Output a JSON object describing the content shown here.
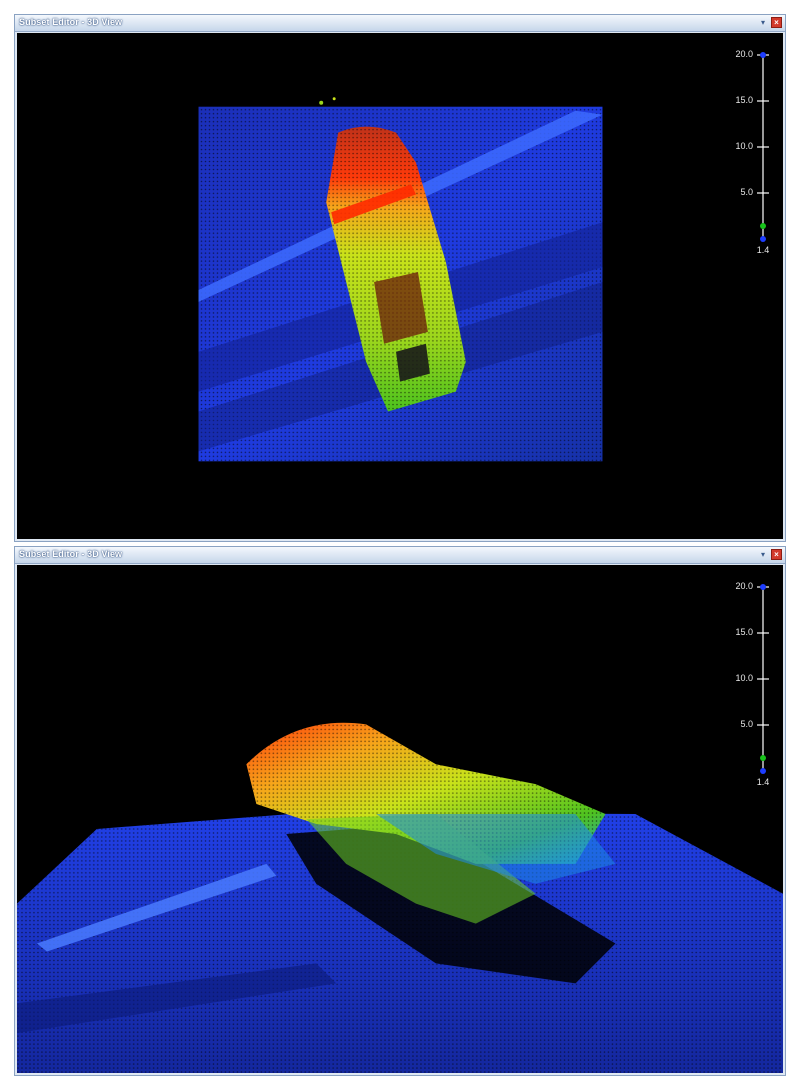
{
  "windows": [
    {
      "title": "Subset Editor - 3D View",
      "scale": {
        "ticks": [
          "20.0",
          "15.0",
          "10.0",
          "5.0"
        ],
        "min_label": "1.4",
        "max_value": 20.0,
        "marker_value": 1.4
      }
    },
    {
      "title": "Subset Editor - 3D View",
      "scale": {
        "ticks": [
          "20.0",
          "15.0",
          "10.0",
          "5.0"
        ],
        "min_label": "1.4",
        "max_value": 20.0,
        "marker_value": 1.4
      }
    }
  ],
  "icons": {
    "pin": "pin-icon",
    "close": "close-icon"
  },
  "colors": {
    "seafloor": "#1e3cff",
    "hull_top": "#ff2a00",
    "hull_mid": "#b5e61d",
    "background": "#000000"
  }
}
